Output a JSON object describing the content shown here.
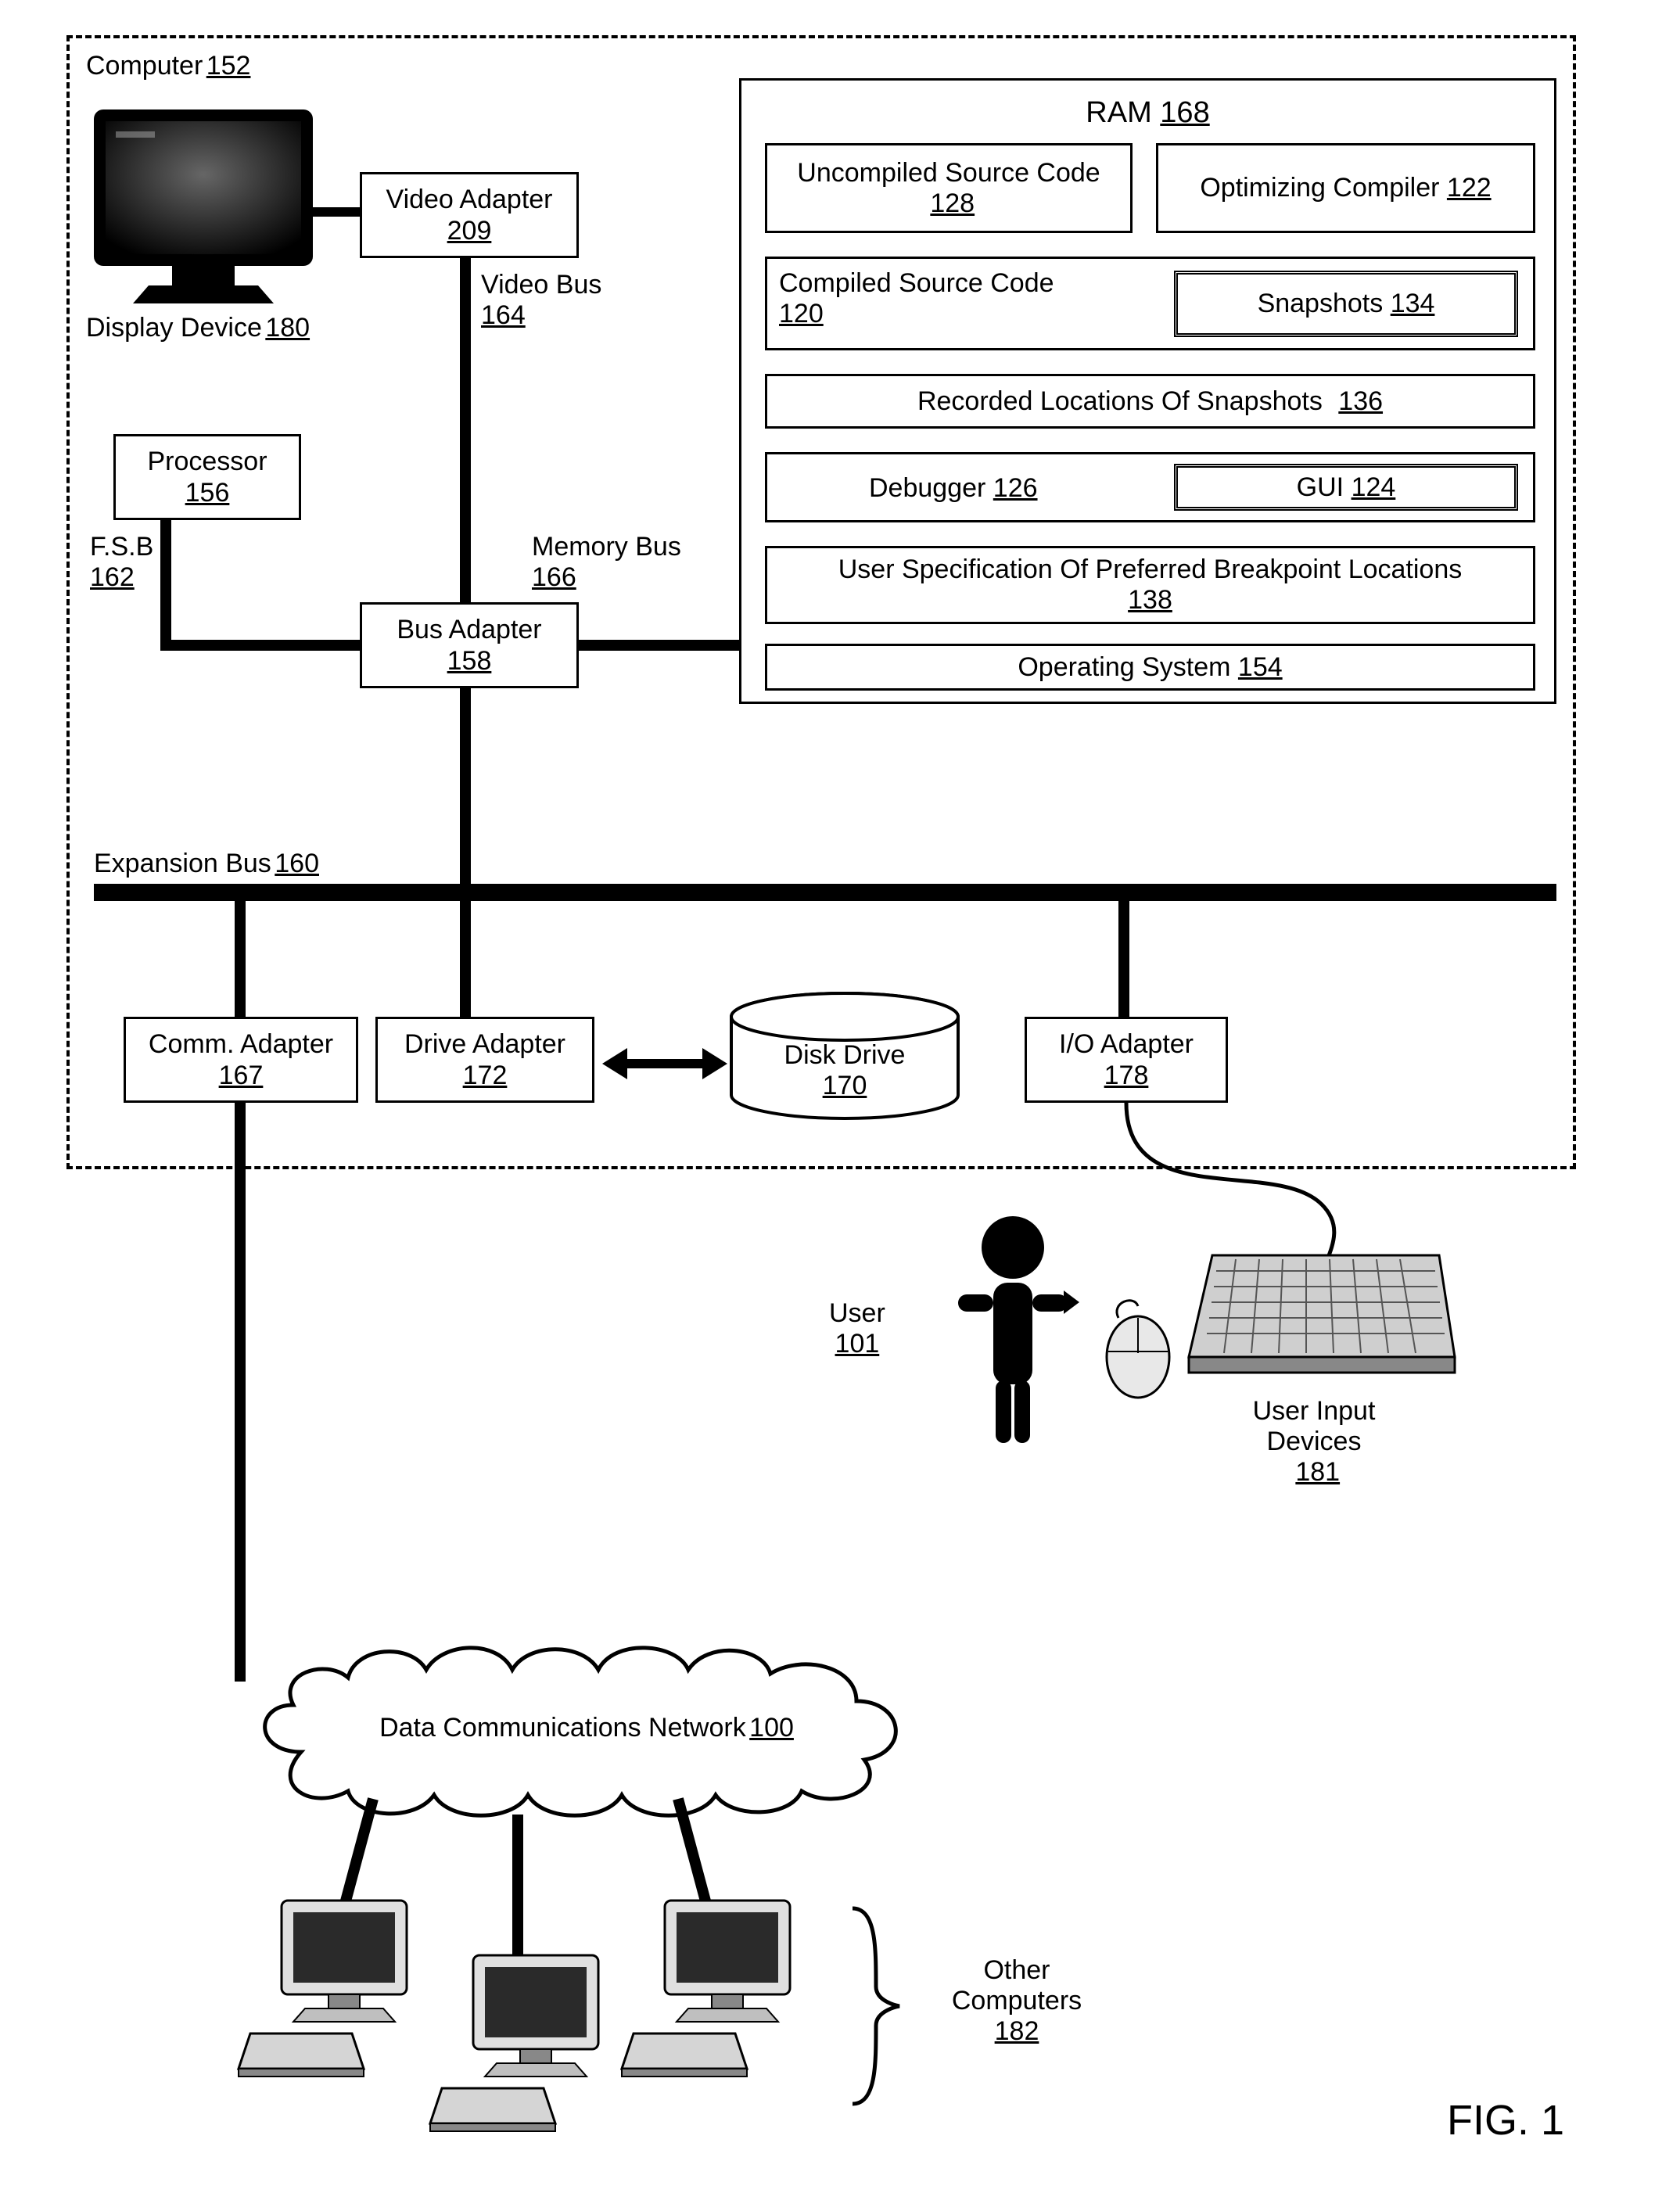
{
  "figure_label": "FIG. 1",
  "computer": {
    "label": "Computer",
    "num": "152"
  },
  "display": {
    "label": "Display Device",
    "num": "180"
  },
  "video_adapter": {
    "label": "Video Adapter",
    "num": "209"
  },
  "video_bus": {
    "label": "Video Bus",
    "num": "164"
  },
  "processor": {
    "label": "Processor",
    "num": "156"
  },
  "fsb": {
    "label": "F.S.B",
    "num": "162"
  },
  "bus_adapter": {
    "label": "Bus Adapter",
    "num": "158"
  },
  "memory_bus": {
    "label": "Memory Bus",
    "num": "166"
  },
  "ram_title": {
    "label": "RAM",
    "num": "168"
  },
  "uncompiled": {
    "label": "Uncompiled Source Code",
    "num": "128"
  },
  "optimizing": {
    "label": "Optimizing Compiler",
    "num": "122"
  },
  "compiled": {
    "label": "Compiled Source Code",
    "num": "120"
  },
  "snapshots": {
    "label": "Snapshots",
    "num": "134"
  },
  "recorded": {
    "label": "Recorded Locations Of Snapshots",
    "num": "136"
  },
  "debugger": {
    "label": "Debugger",
    "num": "126"
  },
  "gui": {
    "label": "GUI",
    "num": "124"
  },
  "userspec": {
    "label": "User Specification Of Preferred Breakpoint Locations",
    "num": "138"
  },
  "os": {
    "label": "Operating System",
    "num": "154"
  },
  "expansion_bus": {
    "label": "Expansion Bus",
    "num": "160"
  },
  "comm_adapter": {
    "label": "Comm. Adapter",
    "num": "167"
  },
  "drive_adapter": {
    "label": "Drive Adapter",
    "num": "172"
  },
  "disk_drive": {
    "label": "Disk Drive",
    "num": "170"
  },
  "io_adapter": {
    "label": "I/O Adapter",
    "num": "178"
  },
  "user": {
    "label": "User",
    "num": "101"
  },
  "user_input": {
    "label": "User Input Devices",
    "num": "181"
  },
  "network": {
    "label": "Data Communications Network",
    "num": "100"
  },
  "other_computers": {
    "label": "Other Computers",
    "num": "182"
  }
}
